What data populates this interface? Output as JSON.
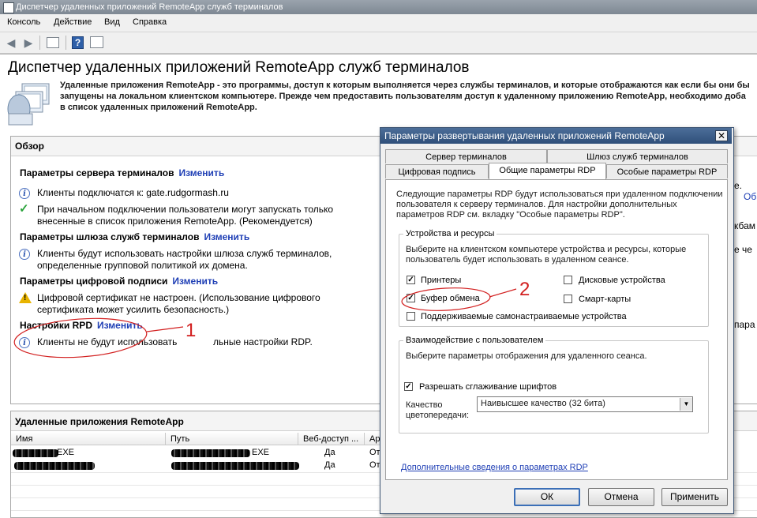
{
  "window": {
    "title": "Диспетчер удаленных приложений RemoteApp служб терминалов"
  },
  "menu": {
    "items": [
      "Консоль",
      "Действие",
      "Вид",
      "Справка"
    ]
  },
  "toolbar": {
    "buttons": [
      "back-icon",
      "forward-icon",
      "properties-icon",
      "help-icon",
      "action-pane-icon"
    ],
    "help_glyph": "?"
  },
  "main": {
    "title": "Диспетчер удаленных приложений RemoteApp служб терминалов",
    "intro_lines": [
      "Удаленные приложения RemoteApp - это программы, доступ к которым выполняется через службы терминалов, и которые отображаются как если бы они бы",
      "запущены на локальном клиентском компьютере. Прежде чем предоставить пользователям доступ к удаленному приложению RemoteApp, необходимо доба",
      "в список удаленных приложений RemoteApp."
    ]
  },
  "overview": {
    "title": "Обзор",
    "change_link": "Изменить",
    "terminal_server": {
      "heading": "Параметры сервера терминалов",
      "items": [
        {
          "icon": "info-icon",
          "lines": [
            "Клиенты подключатся к: gate.rudgormash.ru"
          ]
        },
        {
          "icon": "check-icon",
          "lines": [
            "При начальном подключении пользователи могут запускать только",
            "внесенные в список приложения RemoteApp. (Рекомендуется)"
          ]
        }
      ]
    },
    "gateway": {
      "heading": "Параметры шлюза служб терминалов",
      "items": [
        {
          "icon": "info-icon",
          "lines": [
            "Клиенты будут использовать настройки шлюза служб терминалов,",
            "определенные групповой политикой их домена."
          ]
        }
      ]
    },
    "digital_signature": {
      "heading": "Параметры цифровой подписи",
      "items": [
        {
          "icon": "warning-icon",
          "lines": [
            "Цифровой сертификат не настроен. (Использование цифрового",
            "сертификата может усилить безопасность.)"
          ]
        }
      ]
    },
    "rdp": {
      "heading": "Настройки RPD",
      "items": [
        {
          "icon": "info-icon",
          "lines": [
            "Клиенты не будут использовать",
            "льные настройки RDP."
          ]
        }
      ]
    }
  },
  "right_peek": [
    "е.",
    "Обн",
    "кбам",
    "е че",
    "пара"
  ],
  "apps": {
    "title": "Удаленные приложения RemoteApp",
    "columns": [
      "Имя",
      "Путь",
      "Веб-доступ ...",
      "Ар"
    ],
    "rows": [
      {
        "name": "EXE",
        "path": "EXE",
        "web": "Да",
        "args": "От"
      },
      {
        "name": "",
        "path": "",
        "web": "Да",
        "args": "От"
      }
    ]
  },
  "dialog": {
    "title": "Параметры развертывания удаленных приложений RemoteApp",
    "close_glyph": "✕",
    "tabs_row1": [
      "Сервер терминалов",
      "Шлюз служб терминалов"
    ],
    "tabs_row2": [
      "Цифровая подпись",
      "Общие параметры RDP",
      "Особые параметры RDP"
    ],
    "active_tab": "Общие параметры RDP",
    "description": [
      "Следующие параметры RDP будут использоваться при удаленном подключении",
      "пользователя к серверу терминалов.  Для настройки дополнительных",
      "параметров RDP см. вкладку \"Особые параметры RDP\"."
    ],
    "devices_group": {
      "label": "Устройства и ресурсы",
      "hint": [
        "Выберите на клиентском компьютере устройства и ресурсы, которые",
        "пользователь будет использовать в удаленном сеансе."
      ],
      "checkboxes": [
        {
          "label": "Принтеры",
          "checked": true
        },
        {
          "label": "Дисковые устройства",
          "checked": false
        },
        {
          "label": "Буфер обмена",
          "checked": true
        },
        {
          "label": "Смарт-карты",
          "checked": false
        },
        {
          "label": "Поддерживаемые самонастраиваемые устройства",
          "checked": false
        }
      ]
    },
    "interaction_group": {
      "label": "Взаимодействие с пользователем",
      "hint": "Выберите параметры отображения для удаленного сеанса.",
      "font_smoothing": {
        "label": "Разрешать сглаживание шрифтов",
        "checked": true
      },
      "color_depth_label": [
        "Качество",
        "цветопередачи:"
      ],
      "color_depth_value": "Наивысшее качество (32 бита)"
    },
    "more_info_link": "Дополнительные сведения о параметрах RDP",
    "buttons": {
      "ok": "ОК",
      "cancel": "Отмена",
      "apply": "Применить"
    },
    "check_glyph": "✓"
  },
  "annotations": {
    "label_1": "1",
    "label_2": "2",
    "color": "#d21f1f"
  }
}
